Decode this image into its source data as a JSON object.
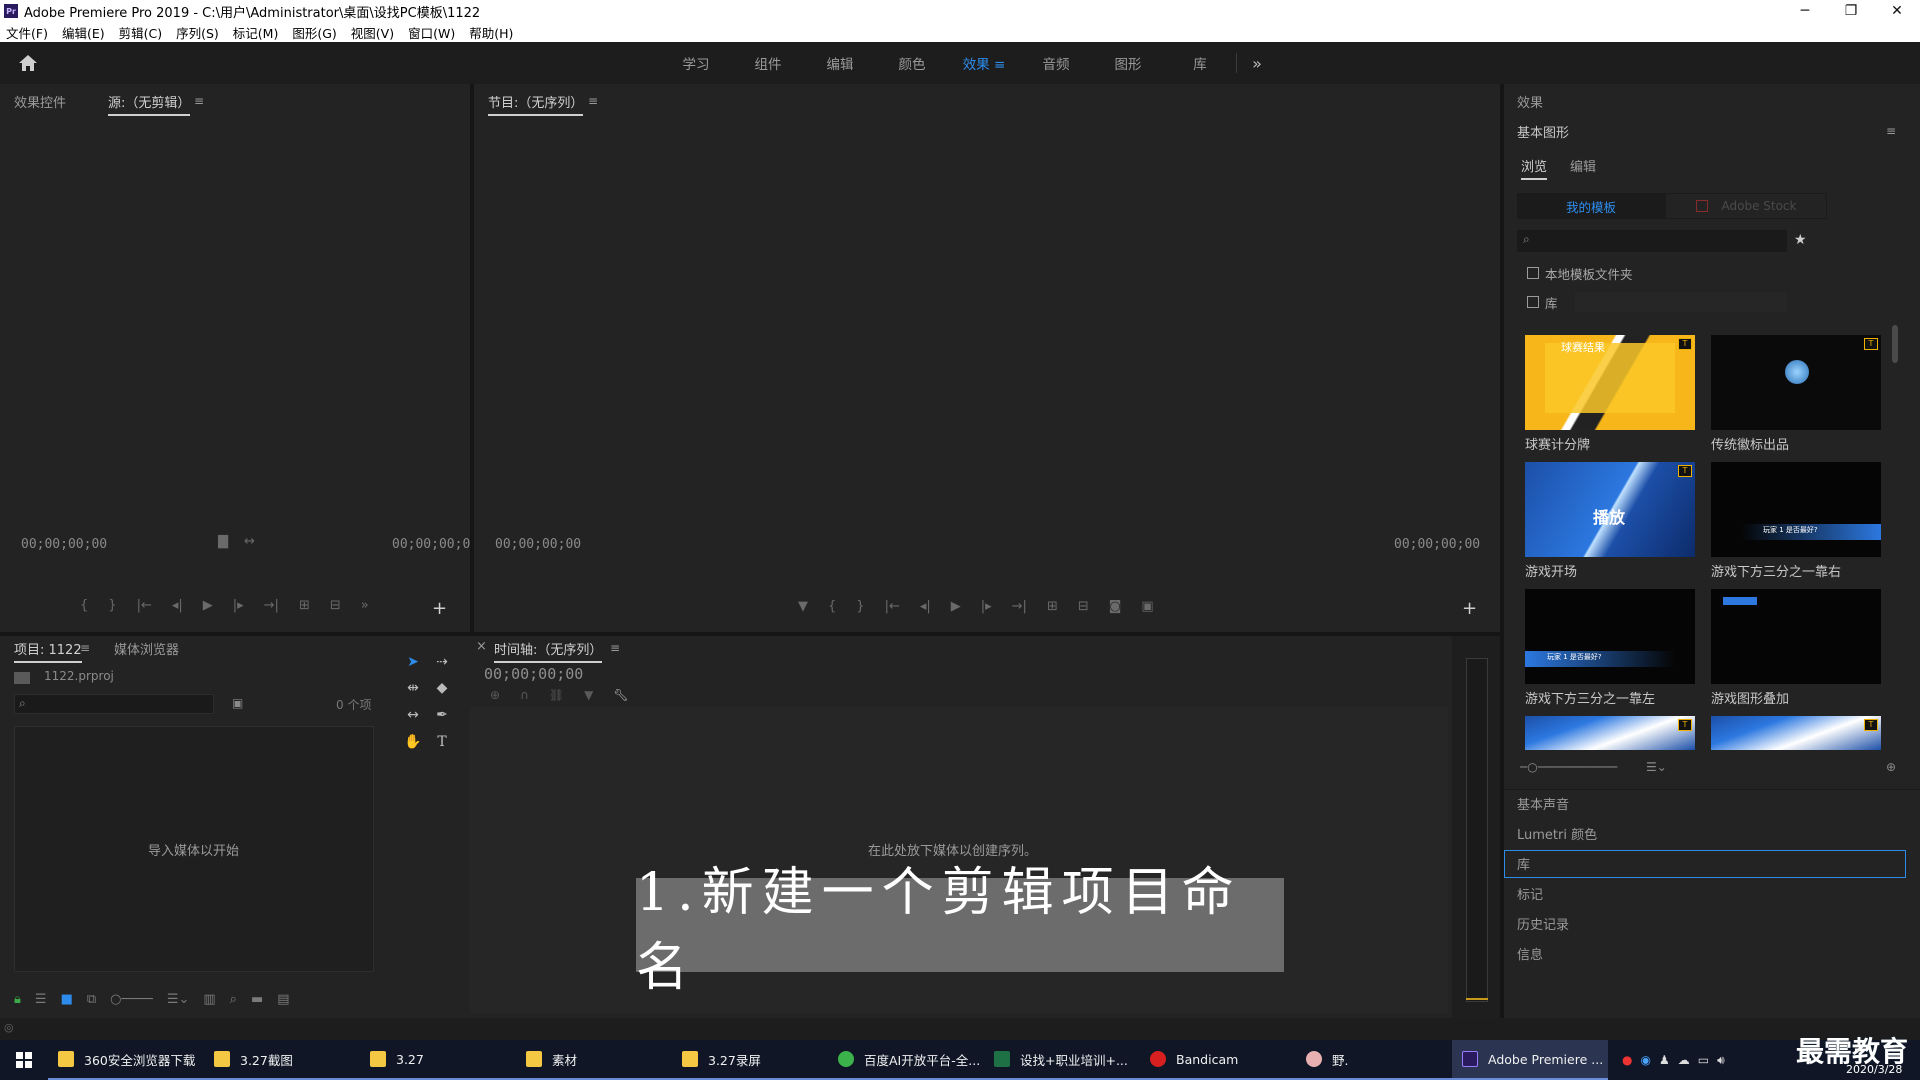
{
  "title_bar": {
    "app_icon": "Pr",
    "title": "Adobe Premiere Pro 2019 - C:\\用户\\Administrator\\桌面\\设找PC模板\\1122",
    "minimize": "─",
    "maximize": "❐",
    "close": "✕"
  },
  "menu": [
    "文件(F)",
    "编辑(E)",
    "剪辑(C)",
    "序列(S)",
    "标记(M)",
    "图形(G)",
    "视图(V)",
    "窗口(W)",
    "帮助(H)"
  ],
  "workspaces": {
    "tabs": [
      "学习",
      "组件",
      "编辑",
      "颜色",
      "效果",
      "音频",
      "图形",
      "库"
    ],
    "active": "效果",
    "active_menu": "≡",
    "more": "»"
  },
  "source_panel": {
    "tabs": [
      "效果控件",
      "源:（无剪辑）"
    ],
    "menu": "≡",
    "timecode_left": "00;00;00;00",
    "timecode_right": "00;00;00;0",
    "add": "+"
  },
  "program_panel": {
    "title": "节目:（无序列）",
    "menu": "≡",
    "timecode_left": "00;00;00;00",
    "timecode_right": "00;00;00;00",
    "add": "+"
  },
  "project_panel": {
    "tabs": [
      "项目: 1122",
      "媒体浏览器"
    ],
    "menu": "≡",
    "file": "1122.prproj",
    "count": "0 个项",
    "empty_text": "导入媒体以开始"
  },
  "timeline_panel": {
    "close": "×",
    "title": "时间轴:（无序列）",
    "menu": "≡",
    "timecode": "00;00;00;00",
    "empty_text": "在此处放下媒体以创建序列。"
  },
  "caption": "1.新建一个剪辑项目命名",
  "right_panel": {
    "header": "效果",
    "section_title": "基本图形",
    "menu": "≡",
    "sub_tabs": [
      "浏览",
      "编辑"
    ],
    "source_buttons": [
      "我的模板",
      "Adobe Stock"
    ],
    "star": "★",
    "local_templates_label": "本地模板文件夹",
    "library_label": "库",
    "templates": [
      {
        "label": "球赛计分牌",
        "thumb_text": "球赛结果"
      },
      {
        "label": "传统徽标出品",
        "thumb_text": ""
      },
      {
        "label": "游戏开场",
        "thumb_text": "播放"
      },
      {
        "label": "游戏下方三分之一靠右",
        "thumb_text": "玩家 1 是否最好?"
      },
      {
        "label": "游戏下方三分之一靠左",
        "thumb_text": "玩家 1 是否最好?"
      },
      {
        "label": "游戏图形叠加",
        "thumb_text": ""
      }
    ],
    "badge": "T",
    "panels": [
      "基本声音",
      "Lumetri 颜色",
      "库",
      "标记",
      "历史记录",
      "信息"
    ],
    "active_panel": "库"
  },
  "taskbar": {
    "items": [
      "360安全浏览器下载",
      "3.27截图",
      "3.27",
      "素材",
      "3.27录屏",
      "百度AI开放平台-全...",
      "设找+职业培训+...",
      "Bandicam",
      "野.",
      "Adobe Premiere ..."
    ],
    "watermark": "最需教育",
    "date": "2020/3/28"
  },
  "colors": {
    "accent": "#2d8ceb",
    "panel_bg": "#232323",
    "taskbar": "#101626"
  }
}
